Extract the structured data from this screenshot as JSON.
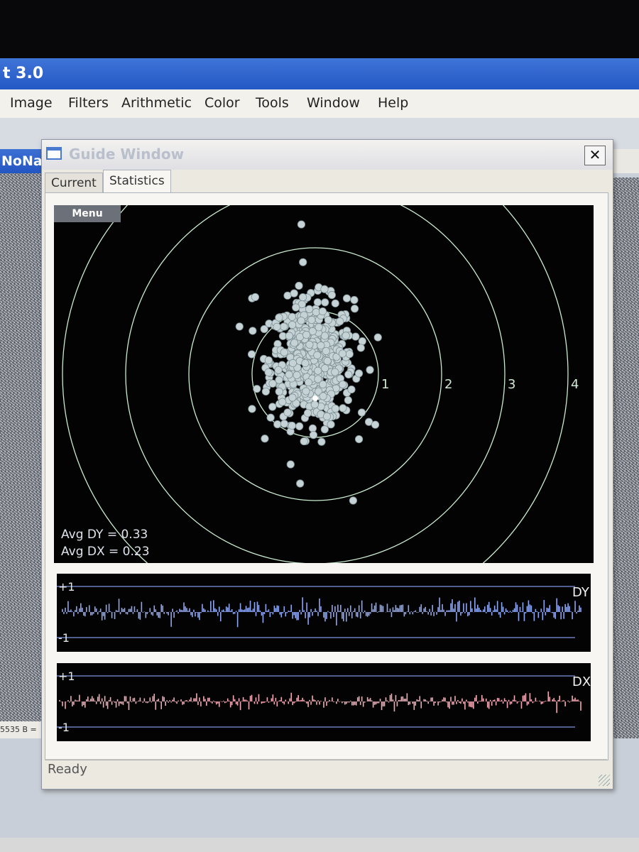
{
  "app": {
    "title": "t 3.0",
    "menu": [
      "Image",
      "Filters",
      "Arithmetic",
      "Color",
      "Tools",
      "Window",
      "Help"
    ]
  },
  "background_windows": {
    "left_title": "NoNa",
    "left_status": "5535  B ="
  },
  "guide_window": {
    "title": "Guide Window",
    "close_label": "✕",
    "tabs": [
      {
        "label": "Current",
        "active": false
      },
      {
        "label": "Statistics",
        "active": true
      }
    ],
    "menu_button": "Menu",
    "ring_labels": [
      "1",
      "2",
      "3",
      "4"
    ],
    "avg_dy": "Avg DY = 0.33",
    "avg_dx": "Avg DX = 0.23",
    "dy_trace": {
      "label": "DY",
      "top": "+1",
      "bottom": "-1",
      "color": "#8fa6f0"
    },
    "dx_trace": {
      "label": "DX",
      "top": "+1",
      "bottom": "-1",
      "color": "#f2a9b5"
    },
    "status": "Ready"
  },
  "chart_data": [
    {
      "type": "scatter",
      "name_note": "",
      "ring_radii": [
        1,
        2,
        3,
        4
      ],
      "center_offset": [
        -0.05,
        0.2
      ],
      "x_spread": 0.33,
      "y_spread": 0.48,
      "point_count": 620,
      "outliers": [
        [
          -0.22,
          2.37
        ],
        [
          0.5,
          1.2
        ],
        [
          0.6,
          -2.0
        ],
        [
          0.95,
          -0.8
        ],
        [
          -1.0,
          -0.55
        ],
        [
          -1.0,
          1.2
        ],
        [
          -0.95,
          1.22
        ],
        [
          0.1,
          -1.07
        ]
      ],
      "point_color": "#c6d3d6"
    },
    {
      "type": "area",
      "series_label": "DY",
      "ylim": [
        -1,
        1
      ],
      "samples": 370,
      "mean": 0.05,
      "noise": 0.22,
      "color": "#8fa6f0"
    },
    {
      "type": "area",
      "series_label": "DX",
      "ylim": [
        -1,
        1
      ],
      "samples": 370,
      "mean": 0.0,
      "noise": 0.15,
      "color": "#f2a9b5"
    }
  ]
}
